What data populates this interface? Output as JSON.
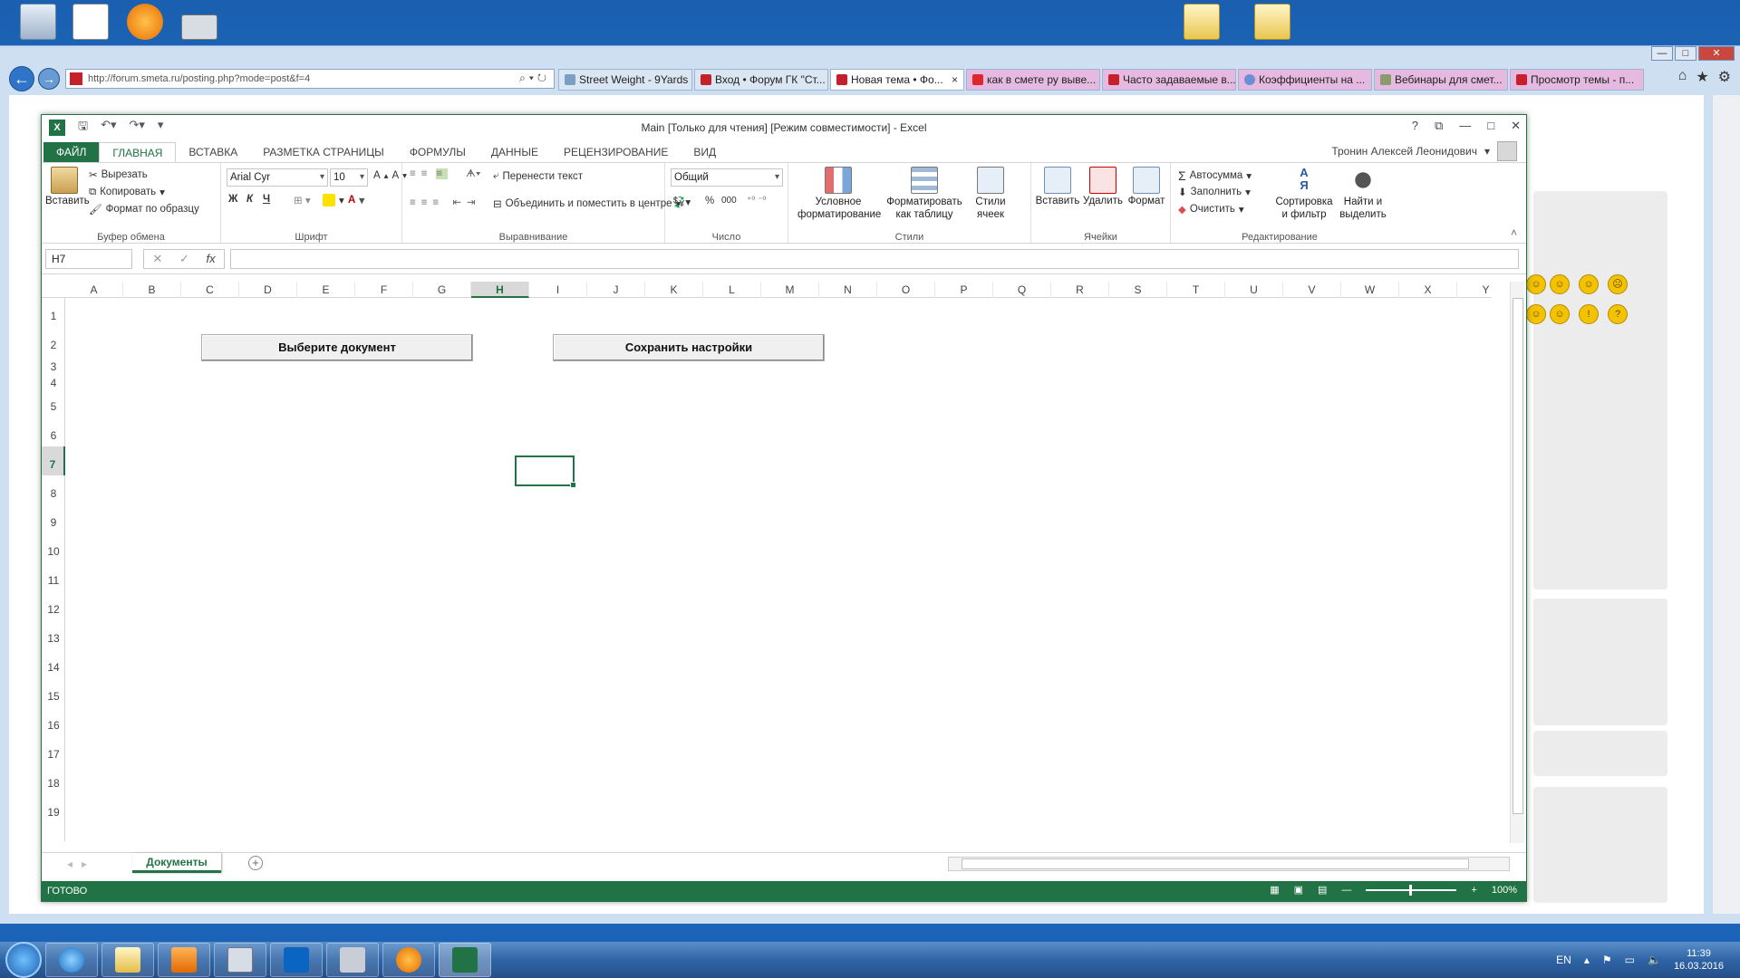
{
  "desktop": {
    "icons": [
      {
        "name": "recycle-bin"
      },
      {
        "name": "document"
      },
      {
        "name": "app-orange"
      },
      {
        "name": "app-window"
      }
    ],
    "folders": [
      {
        "name": "folder-1"
      },
      {
        "name": "folder-2"
      }
    ]
  },
  "browser": {
    "address": "http://forum.smeta.ru/posting.php?mode=post&f=4",
    "tabs": [
      {
        "label": "Street Weight - 9Yards"
      },
      {
        "label": "Вход • Форум ГК \"Ст..."
      },
      {
        "label": "Новая тема • Фо...",
        "close": "×"
      },
      {
        "label": "как в смете ру выве..."
      },
      {
        "label": "Часто задаваемые в..."
      },
      {
        "label": "Коэффициенты на ..."
      },
      {
        "label": "Вебинары для смет..."
      },
      {
        "label": "Просмотр темы - п..."
      }
    ],
    "controls": {
      "min": "—",
      "max": "□",
      "close": "✕"
    }
  },
  "excel": {
    "title": "Main  [Только для чтения]  [Режим совместимости] - Excel",
    "title_controls": {
      "help": "?",
      "restore": "⧉",
      "min": "—",
      "max": "□",
      "close": "✕"
    },
    "menu": [
      "ФАЙЛ",
      "ГЛАВНАЯ",
      "ВСТАВКА",
      "РАЗМЕТКА СТРАНИЦЫ",
      "ФОРМУЛЫ",
      "ДАННЫЕ",
      "РЕЦЕНЗИРОВАНИЕ",
      "ВИД"
    ],
    "user": "Тронин Алексей Леонидович",
    "ribbon": {
      "clipboard": {
        "label": "Буфер обмена",
        "paste": "Вставить",
        "cut": "Вырезать",
        "copy": "Копировать",
        "format_painter": "Формат по образцу"
      },
      "font": {
        "label": "Шрифт",
        "name": "Arial Cyr",
        "size": "10",
        "bold": "Ж",
        "italic": "К",
        "underline": "Ч"
      },
      "alignment": {
        "label": "Выравнивание",
        "wrap": "Перенести текст",
        "merge": "Объединить и поместить в центре"
      },
      "number": {
        "label": "Число",
        "format": "Общий",
        "percent": "%",
        "thousands": "000"
      },
      "styles": {
        "label": "Стили",
        "conditional": [
          "Условное",
          "форматирование"
        ],
        "as_table": [
          "Форматировать",
          "как таблицу"
        ],
        "cell_styles": [
          "Стили",
          "ячеек"
        ]
      },
      "cells": {
        "label": "Ячейки",
        "insert": "Вставить",
        "delete": "Удалить",
        "format": "Формат"
      },
      "editing": {
        "label": "Редактирование",
        "autosum": "Автосумма",
        "fill": "Заполнить",
        "clear": "Очистить",
        "sort": [
          "Сортировка",
          "и фильтр"
        ],
        "find": [
          "Найти и",
          "выделить"
        ]
      }
    },
    "name_box": "H7",
    "fx": "fx",
    "columns": [
      "A",
      "B",
      "C",
      "D",
      "E",
      "F",
      "G",
      "H",
      "I",
      "J",
      "K",
      "L",
      "M",
      "N",
      "O",
      "P",
      "Q",
      "R",
      "S",
      "T",
      "U",
      "V",
      "W",
      "X",
      "Y"
    ],
    "rows": [
      "1",
      "2",
      "3",
      "4",
      "5",
      "6",
      "7",
      "8",
      "9",
      "10",
      "11",
      "12",
      "13",
      "14",
      "15",
      "16",
      "17",
      "18",
      "19"
    ],
    "selected_col": "H",
    "selected_row": "7",
    "buttons": {
      "choose_doc": "Выберите документ",
      "save_settings": "Сохранить настройки"
    },
    "sheet_tab": "Документы",
    "add_sheet": "+",
    "status": "ГОТОВО",
    "zoom": "100%"
  },
  "taskbar": {
    "lang": "EN",
    "time": "11:39",
    "date": "16.03.2016"
  },
  "colors": {
    "excel_green": "#217346",
    "taskbar": "#2f64a6"
  }
}
